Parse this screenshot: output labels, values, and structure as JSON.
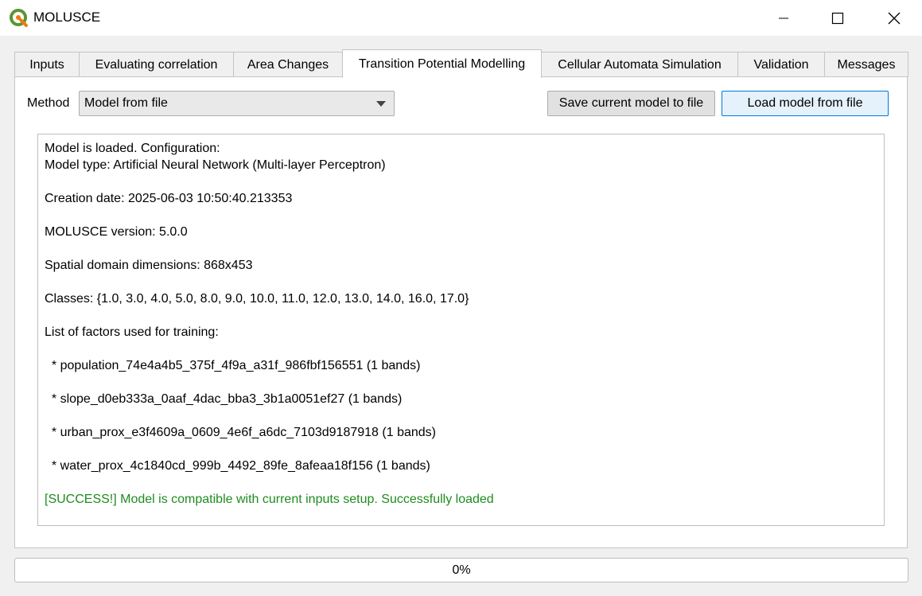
{
  "window": {
    "title": "MOLUSCE",
    "app_icon": "qgis-logo-icon",
    "controls": [
      "minimize-icon",
      "maximize-icon",
      "close-icon"
    ]
  },
  "tabs": [
    {
      "label": "Inputs",
      "active": false
    },
    {
      "label": "Evaluating correlation",
      "active": false
    },
    {
      "label": "Area Changes",
      "active": false
    },
    {
      "label": "Transition Potential Modelling",
      "active": true
    },
    {
      "label": "Cellular Automata Simulation",
      "active": false
    },
    {
      "label": "Validation",
      "active": false
    },
    {
      "label": "Messages",
      "active": false
    }
  ],
  "method": {
    "label": "Method",
    "selected": "Model from file"
  },
  "buttons": {
    "save": "Save current model to file",
    "load": "Load model from file"
  },
  "log": {
    "lines": [
      {
        "text": "Model is loaded. Configuration:",
        "type": "info"
      },
      {
        "text": "Model type: Artificial Neural Network (Multi-layer Perceptron)",
        "type": "info"
      },
      {
        "text": "Creation date: 2025-06-03 10:50:40.213353",
        "type": "info"
      },
      {
        "text": "MOLUSCE version: 5.0.0",
        "type": "info"
      },
      {
        "text": "Spatial domain dimensions: 868x453",
        "type": "info"
      },
      {
        "text": "Classes: {1.0, 3.0, 4.0, 5.0, 8.0, 9.0, 10.0, 11.0, 12.0, 13.0, 14.0, 16.0, 17.0}",
        "type": "info"
      },
      {
        "text": "List of factors used for training:",
        "type": "info"
      },
      {
        "text": "  * population_74e4a4b5_375f_4f9a_a31f_986fbf156551 (1 bands)",
        "type": "info"
      },
      {
        "text": "  * slope_d0eb333a_0aaf_4dac_bba3_3b1a0051ef27 (1 bands)",
        "type": "info"
      },
      {
        "text": "  * urban_prox_e3f4609a_0609_4e6f_a6dc_7103d9187918 (1 bands)",
        "type": "info"
      },
      {
        "text": "  * water_prox_4c1840cd_999b_4492_89fe_8afeaa18f156 (1 bands)",
        "type": "info"
      },
      {
        "text": "[SUCCESS!] Model is compatible with current inputs setup. Successfully loaded",
        "type": "success"
      }
    ],
    "success_color": "#1e8c1e"
  },
  "progress": {
    "value": 0,
    "label": "0%"
  }
}
